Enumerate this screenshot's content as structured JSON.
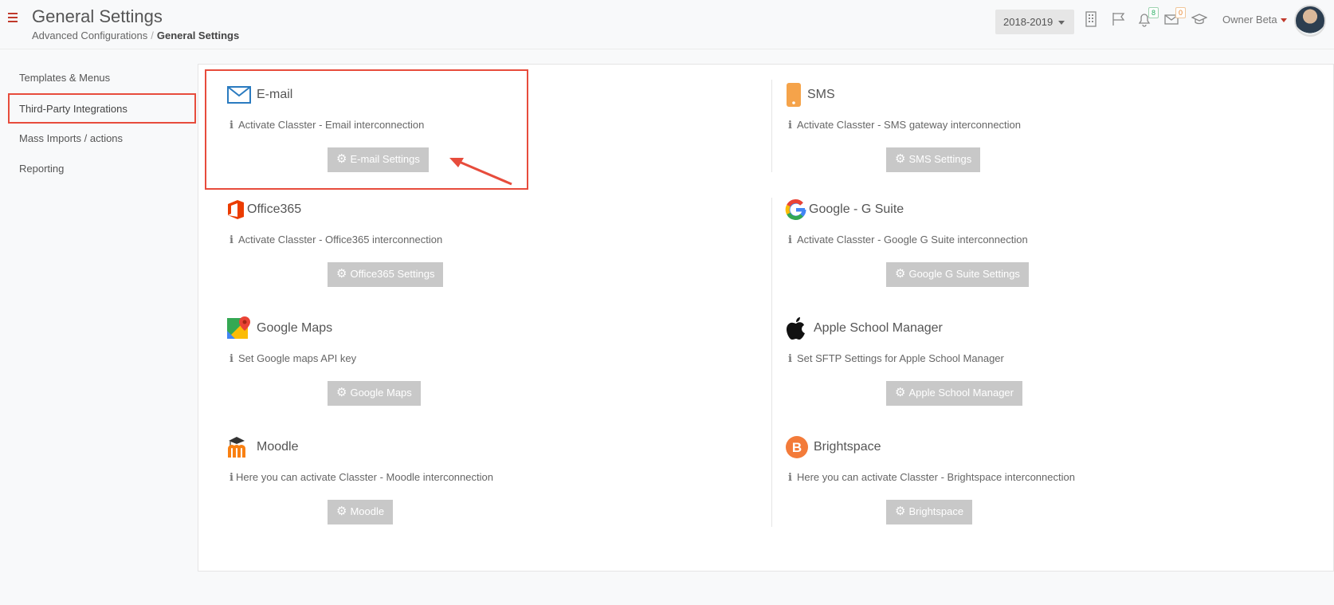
{
  "header": {
    "title": "General Settings",
    "breadcrumb": {
      "parent": "Advanced Configurations",
      "separator": "/",
      "current": "General Settings"
    },
    "year": "2018-2019",
    "notifications_count": "8",
    "messages_count": "0",
    "user_name": "Owner Beta"
  },
  "sidebar": {
    "items": [
      {
        "label": "Templates & Menus"
      },
      {
        "label": "Third-Party Integrations"
      },
      {
        "label": "Mass Imports / actions"
      },
      {
        "label": "Reporting"
      }
    ]
  },
  "cards": {
    "email": {
      "title": "E-mail",
      "desc": "Activate Classter - Email interconnection",
      "button": "E-mail Settings"
    },
    "sms": {
      "title": "SMS",
      "desc": "Activate Classter - SMS gateway interconnection",
      "button": "SMS Settings"
    },
    "office365": {
      "title": "Office365",
      "desc": "Activate Classter - Office365 interconnection",
      "button": "Office365 Settings"
    },
    "gsuite": {
      "title": "Google - G Suite",
      "desc": "Activate Classter - Google G Suite interconnection",
      "button": "Google G Suite Settings"
    },
    "maps": {
      "title": "Google Maps",
      "desc": "Set Google maps API key",
      "button": "Google Maps"
    },
    "apple": {
      "title": "Apple School Manager",
      "desc": "Set SFTP Settings for Apple School Manager",
      "button": "Apple School Manager"
    },
    "moodle": {
      "title": "Moodle",
      "desc": "Here you can activate Classter - Moodle interconnection",
      "button": "Moodle"
    },
    "brightspace": {
      "title": "Brightspace",
      "desc": "Here you can activate Classter - Brightspace interconnection",
      "button": "Brightspace"
    }
  },
  "colors": {
    "accent": "#c0392b",
    "highlight": "#e74c3c",
    "button_bg": "#c8c8c8"
  }
}
